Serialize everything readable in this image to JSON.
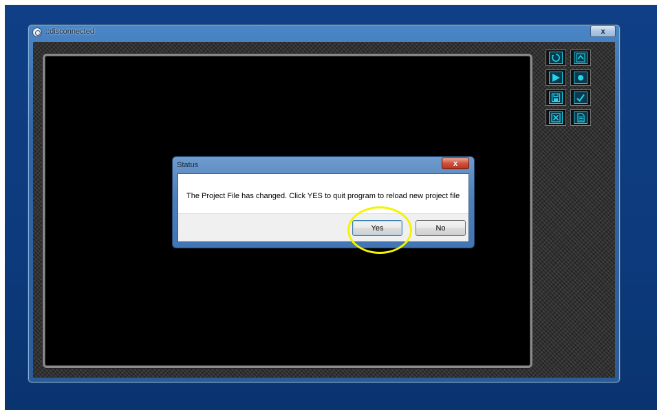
{
  "app_window": {
    "title": "::disconnected",
    "close_label": "x"
  },
  "toolbar": {
    "buttons": [
      {
        "name": "reset-button",
        "icon": "circular-arrow-icon"
      },
      {
        "name": "maximize-button",
        "icon": "caret-up-icon"
      },
      {
        "name": "play-button",
        "icon": "play-icon"
      },
      {
        "name": "record-button",
        "icon": "dot-icon"
      },
      {
        "name": "save-button",
        "icon": "floppy-icon"
      },
      {
        "name": "check-button",
        "icon": "checkmark-icon"
      },
      {
        "name": "cancel-button",
        "icon": "x-box-icon"
      },
      {
        "name": "document-button",
        "icon": "document-icon"
      }
    ]
  },
  "dialog": {
    "title": "Status",
    "close_label": "x",
    "message": "The Project File has changed. Click YES to quit program to reload new project file",
    "yes_label": "Yes",
    "no_label": "No"
  },
  "colors": {
    "desktop": "#0c3a7c",
    "accent_cyan": "#22d6ec",
    "highlight": "#f4f400"
  }
}
